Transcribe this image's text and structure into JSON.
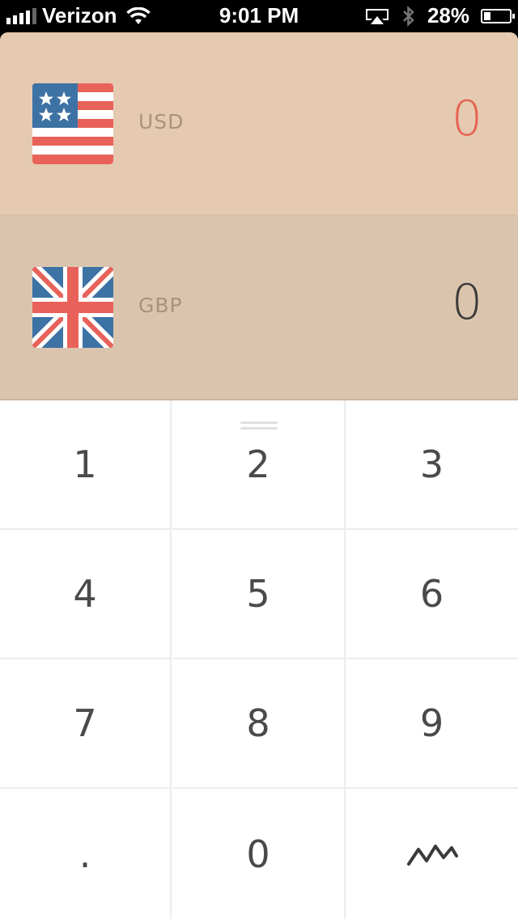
{
  "status_bar": {
    "carrier": "Verizon",
    "time": "9:01 PM",
    "battery": "28%",
    "battery_level": 0.28
  },
  "converter": {
    "rows": [
      {
        "code": "USD",
        "amount": "0",
        "flag": "us-flag-icon",
        "active": true,
        "amount_color": "#e56350"
      },
      {
        "code": "GBP",
        "amount": "0",
        "flag": "uk-flag-icon",
        "active": false,
        "amount_color": "#3a3a3a"
      }
    ]
  },
  "keypad": {
    "keys": [
      "1",
      "2",
      "3",
      "4",
      "5",
      "6",
      "7",
      "8",
      "9",
      ".",
      "0"
    ],
    "chart_key_icon": "chart-line-icon"
  },
  "colors": {
    "usd_row_bg": "#e5cab1",
    "gbp_row_bg": "#dbc4ad",
    "accent_red": "#e56350",
    "flag_blue": "#3d72a4",
    "flag_red": "#e8625a"
  }
}
